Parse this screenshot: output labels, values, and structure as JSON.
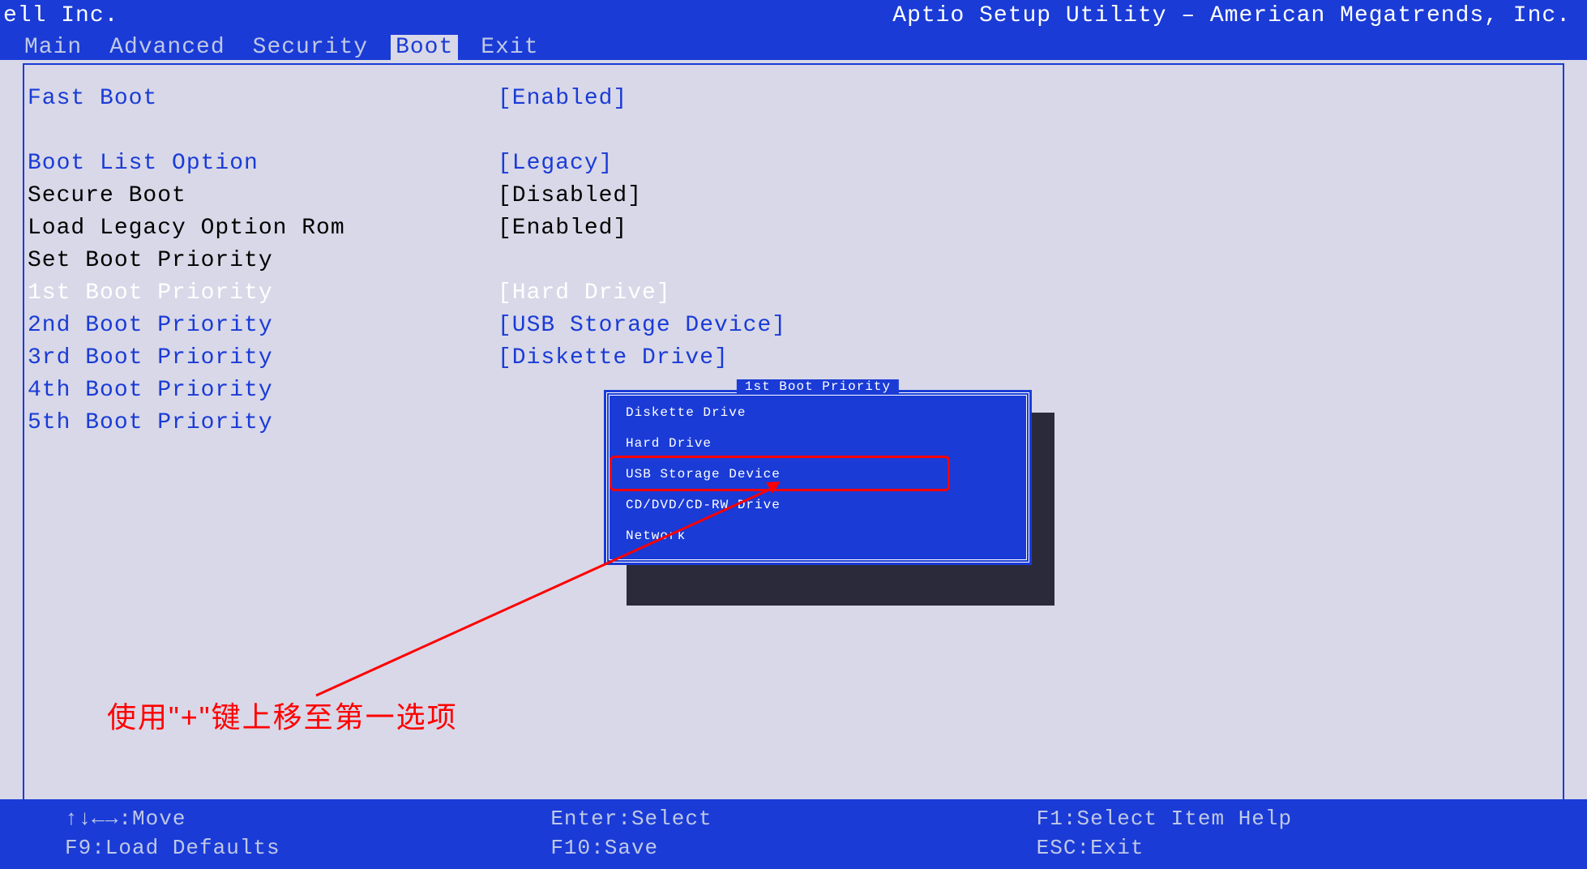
{
  "brand": "ell Inc.",
  "utility_title": "Aptio Setup Utility – American Megatrends, Inc.",
  "tabs": {
    "main": "Main",
    "advanced": "Advanced",
    "security": "Security",
    "boot": "Boot",
    "exit": "Exit"
  },
  "settings": {
    "fast_boot": {
      "label": "Fast Boot",
      "value": "[Enabled]"
    },
    "boot_list_option": {
      "label": "Boot List Option",
      "value": "[Legacy]"
    },
    "secure_boot": {
      "label": "Secure Boot",
      "value": "[Disabled]"
    },
    "load_legacy_rom": {
      "label": "Load Legacy Option Rom",
      "value": "[Enabled]"
    },
    "set_boot_priority": {
      "label": "Set Boot Priority"
    },
    "first": {
      "label": "1st Boot Priority",
      "value": "[Hard Drive]"
    },
    "second": {
      "label": "2nd Boot Priority",
      "value": "[USB Storage Device]"
    },
    "third": {
      "label": "3rd Boot Priority",
      "value": "[Diskette Drive]"
    },
    "fourth": {
      "label": "4th Boot Priority"
    },
    "fifth": {
      "label": "5th Boot Priority"
    }
  },
  "popup": {
    "title": "1st Boot Priority",
    "options": [
      "Diskette Drive",
      "Hard Drive",
      "USB Storage Device",
      "CD/DVD/CD-RW Drive",
      "Network"
    ]
  },
  "annotation": {
    "text": "使用\"+\"键上移至第一选项"
  },
  "footer": {
    "move": "↑↓←→:Move",
    "load_defaults": "F9:Load Defaults",
    "enter_select": "Enter:Select",
    "save": "F10:Save",
    "help": "F1:Select Item Help",
    "exit": "ESC:Exit"
  }
}
